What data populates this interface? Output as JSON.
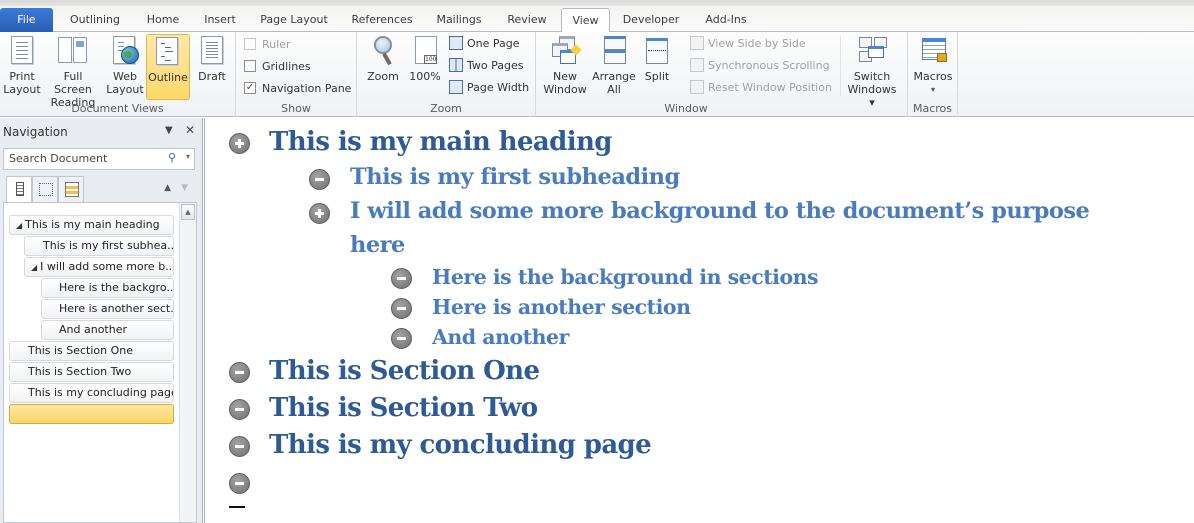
{
  "tabs": [
    {
      "label": "File",
      "id": "file"
    },
    {
      "label": "Outlining",
      "id": "outlining"
    },
    {
      "label": "Home",
      "id": "home"
    },
    {
      "label": "Insert",
      "id": "insert"
    },
    {
      "label": "Page Layout",
      "id": "page-layout"
    },
    {
      "label": "References",
      "id": "references"
    },
    {
      "label": "Mailings",
      "id": "mailings"
    },
    {
      "label": "Review",
      "id": "review"
    },
    {
      "label": "View",
      "id": "view",
      "active": true
    },
    {
      "label": "Developer",
      "id": "developer"
    },
    {
      "label": "Add-Ins",
      "id": "add-ins"
    }
  ],
  "ribbon": {
    "document_views": {
      "label": "Document Views",
      "print_layout": "Print\nLayout",
      "print_layout_l1": "Print",
      "print_layout_l2": "Layout",
      "full_screen_l1": "Full Screen",
      "full_screen_l2": "Reading",
      "web_layout_l1": "Web",
      "web_layout_l2": "Layout",
      "outline": "Outline",
      "draft": "Draft",
      "selected": "Outline"
    },
    "show": {
      "label": "Show",
      "ruler": {
        "label": "Ruler",
        "checked": false,
        "enabled": false
      },
      "gridlines": {
        "label": "Gridlines",
        "checked": false
      },
      "navigation_pane": {
        "label": "Navigation Pane",
        "checked": true
      }
    },
    "zoom": {
      "label": "Zoom",
      "zoom": "Zoom",
      "hundred": "100%",
      "hundred_icon_text": "100",
      "one_page": "One Page",
      "two_pages": "Two Pages",
      "page_width": "Page Width"
    },
    "window": {
      "label": "Window",
      "new_window_l1": "New",
      "new_window_l2": "Window",
      "arrange_all_l1": "Arrange",
      "arrange_all_l2": "All",
      "split": "Split",
      "view_side_by_side": "View Side by Side",
      "synchronous_scrolling": "Synchronous Scrolling",
      "reset_window_position": "Reset Window Position",
      "switch_windows_l1": "Switch",
      "switch_windows_l2": "Windows ▾"
    },
    "macros": {
      "label": "Macros",
      "macros": "Macros",
      "arrow": "▾"
    }
  },
  "navigation": {
    "title": "Navigation",
    "menu_glyph": "▼",
    "close_glyph": "✕",
    "search_placeholder": "Search Document",
    "search_glyph": "⚲",
    "dropdown_glyph": "▾",
    "up_glyph": "▲",
    "down_glyph": "▼",
    "tree": [
      {
        "label": "This is my main heading",
        "level": 1,
        "expanded": true
      },
      {
        "label": "This is my first subhea...",
        "level": 2
      },
      {
        "label": "I will add some more b...",
        "level": 2,
        "expanded": true
      },
      {
        "label": "Here is the backgro...",
        "level": 3
      },
      {
        "label": "Here is another sect...",
        "level": 3
      },
      {
        "label": "And another",
        "level": 3
      },
      {
        "label": "This is Section One",
        "level": 1
      },
      {
        "label": "This is Section Two",
        "level": 1
      },
      {
        "label": "This is my concluding page",
        "level": 1
      },
      {
        "label": "",
        "level": 1,
        "selected": true
      }
    ]
  },
  "document": {
    "outline": [
      {
        "text": "This is my main heading",
        "level": 1,
        "symbol": "plus"
      },
      {
        "text": "This is my first subheading",
        "level": 2,
        "symbol": "minus"
      },
      {
        "text": "I will add some more background to the document’s purpose",
        "level": 2,
        "symbol": "plus"
      },
      {
        "text": "here",
        "level": 2,
        "symbol": "none",
        "continuation": true
      },
      {
        "text": "Here is the background in sections",
        "level": 3,
        "symbol": "minus"
      },
      {
        "text": "Here is another section",
        "level": 3,
        "symbol": "minus"
      },
      {
        "text": "And another",
        "level": 3,
        "symbol": "minus"
      },
      {
        "text": "This is Section One",
        "level": 1,
        "symbol": "minus"
      },
      {
        "text": "This is Section Two",
        "level": 1,
        "symbol": "minus"
      },
      {
        "text": "This is my concluding page",
        "level": 1,
        "symbol": "minus"
      },
      {
        "text": "",
        "level": 1,
        "symbol": "minus"
      }
    ]
  },
  "colors": {
    "heading1": "#2f5b94",
    "heading2": "#4a7bbd",
    "file_tab": "#2a5fb6",
    "selected": "#fcd66a"
  }
}
